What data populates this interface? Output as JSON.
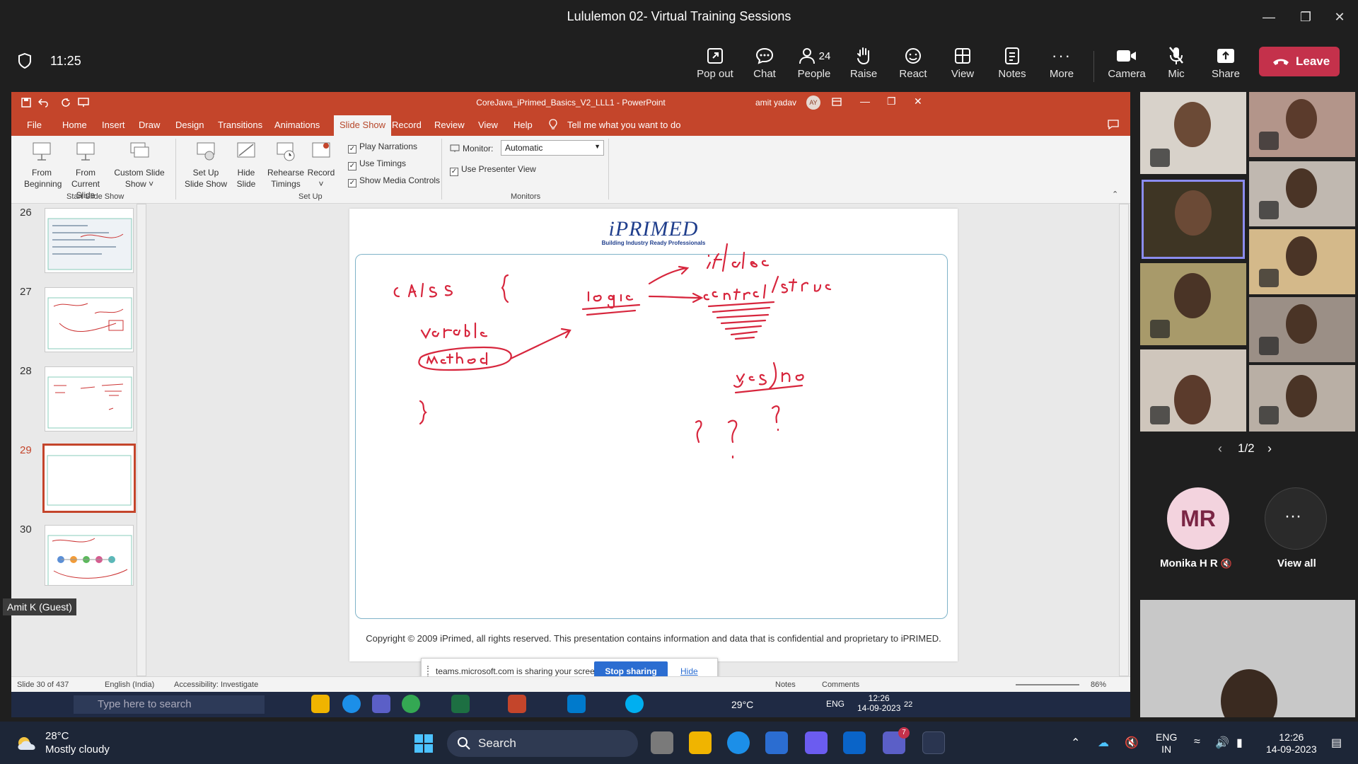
{
  "teams": {
    "window_title": "Lululemon 02- Virtual Training Sessions",
    "timer": "11:25",
    "toolbar": [
      {
        "label": "Pop out",
        "icon": "pop-out-icon"
      },
      {
        "label": "Chat",
        "icon": "chat-icon"
      },
      {
        "label": "People",
        "icon": "people-icon",
        "count": "24"
      },
      {
        "label": "Raise",
        "icon": "raise-hand-icon"
      },
      {
        "label": "React",
        "icon": "react-icon"
      },
      {
        "label": "View",
        "icon": "view-icon"
      },
      {
        "label": "Notes",
        "icon": "notes-icon"
      },
      {
        "label": "More",
        "icon": "more-icon"
      },
      {
        "label": "Camera",
        "icon": "camera-icon"
      },
      {
        "label": "Mic",
        "icon": "mic-off-icon"
      },
      {
        "label": "Share",
        "icon": "share-icon"
      }
    ],
    "leave_label": "Leave",
    "leave_color": "#c4314b"
  },
  "powerpoint": {
    "title": "CoreJava_iPrimed_Basics_V2_LLL1  -  PowerPoint",
    "user": "amit yadav",
    "user_initials": "AY",
    "tabs": [
      "File",
      "Home",
      "Insert",
      "Draw",
      "Design",
      "Transitions",
      "Animations",
      "Slide Show",
      "Record",
      "Review",
      "View",
      "Help"
    ],
    "active_tab": "Slide Show",
    "tell_me": "Tell me what you want to do",
    "ribbon": {
      "from_beginning": [
        "From",
        "Beginning"
      ],
      "from_current": [
        "From",
        "Current Slide"
      ],
      "custom_show": [
        "Custom Slide",
        "Show ˅"
      ],
      "setup_show": [
        "Set Up",
        "Slide Show"
      ],
      "hide_slide": [
        "Hide",
        "Slide"
      ],
      "rehearse": [
        "Rehearse",
        "Timings"
      ],
      "record": [
        "Record",
        "˅"
      ],
      "play_narrations": "Play Narrations",
      "use_timings": "Use Timings",
      "show_media_controls": "Show Media Controls",
      "monitor_label": "Monitor:",
      "monitor_value": "Automatic",
      "use_presenter_view": "Use Presenter View",
      "groups": {
        "start": "Start Slide Show",
        "setup": "Set Up",
        "monitors": "Monitors"
      }
    },
    "thumbnails": [
      {
        "num": "26",
        "selected": false
      },
      {
        "num": "27",
        "selected": false
      },
      {
        "num": "28",
        "selected": false
      },
      {
        "num": "29",
        "selected": true
      },
      {
        "num": "30",
        "selected": false
      }
    ],
    "slide": {
      "logo": "iPRIMED",
      "tagline": "Building Industry Ready Professionals",
      "copyright": "Copyright © 2009 iPrimed, all rights reserved. This presentation contains information  and data  that is confidential and proprietary to iPRIMED."
    },
    "share_notice": {
      "message": "teams.microsoft.com is sharing your screen.",
      "stop": "Stop sharing",
      "hide": "Hide"
    },
    "status": {
      "slide": "Slide 30 of 437",
      "language": "English (India)",
      "accessibility": "Accessibility: Investigate",
      "notes": "Notes",
      "comments": "Comments",
      "zoom": "86%"
    },
    "inner_taskbar": {
      "guest": "Amit K (Guest)",
      "search": "Type here to search",
      "temp": "29°C",
      "lang": "ENG",
      "time": "12:26",
      "date": "14-09-2023",
      "notif": "22"
    }
  },
  "participants": {
    "pager": "1/2",
    "featured": {
      "initials": "MR",
      "name": "Monika H R"
    },
    "view_all": "View all"
  },
  "windows": {
    "weather_temp": "28°C",
    "weather_desc": "Mostly cloudy",
    "search": "Search",
    "lang_top": "ENG",
    "lang_bottom": "IN",
    "time": "12:26",
    "date": "14-09-2023",
    "teams_badge": "7"
  }
}
